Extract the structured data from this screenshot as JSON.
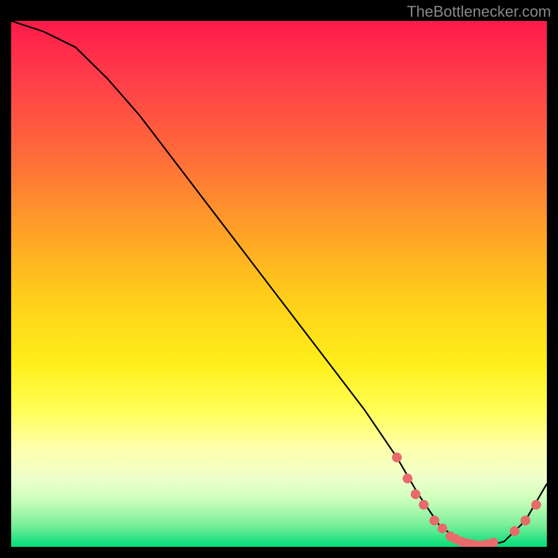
{
  "attribution": "TheBottlenecker.com",
  "chart_data": {
    "type": "line",
    "title": "",
    "xlabel": "",
    "ylabel": "",
    "xlim": [
      0,
      100
    ],
    "ylim": [
      0,
      100
    ],
    "series": [
      {
        "name": "bottleneck-curve",
        "x": [
          0,
          6,
          12,
          18,
          24,
          30,
          36,
          42,
          48,
          54,
          60,
          66,
          72,
          76,
          80,
          84,
          88,
          92,
          96,
          100
        ],
        "y": [
          100,
          98,
          95,
          89,
          82,
          74,
          66,
          58,
          50,
          42,
          34,
          26,
          17,
          10,
          4,
          1,
          0,
          1,
          5,
          12
        ]
      }
    ],
    "markers": {
      "name": "highlighted-points",
      "color": "#e86a6a",
      "points": [
        {
          "x": 72,
          "y": 17
        },
        {
          "x": 74,
          "y": 13
        },
        {
          "x": 75.5,
          "y": 10
        },
        {
          "x": 77,
          "y": 8
        },
        {
          "x": 79,
          "y": 5
        },
        {
          "x": 80.5,
          "y": 3.5
        },
        {
          "x": 82,
          "y": 2
        },
        {
          "x": 83,
          "y": 1.5
        },
        {
          "x": 84,
          "y": 1
        },
        {
          "x": 85,
          "y": 0.7
        },
        {
          "x": 86,
          "y": 0.5
        },
        {
          "x": 87,
          "y": 0.3
        },
        {
          "x": 88,
          "y": 0.3
        },
        {
          "x": 89,
          "y": 0.5
        },
        {
          "x": 90,
          "y": 0.8
        },
        {
          "x": 94,
          "y": 3
        },
        {
          "x": 96,
          "y": 5
        },
        {
          "x": 98,
          "y": 8
        }
      ]
    },
    "background_gradient": {
      "top": "#ff1a4a",
      "mid": "#ffee1a",
      "bottom": "#00dd77"
    }
  }
}
